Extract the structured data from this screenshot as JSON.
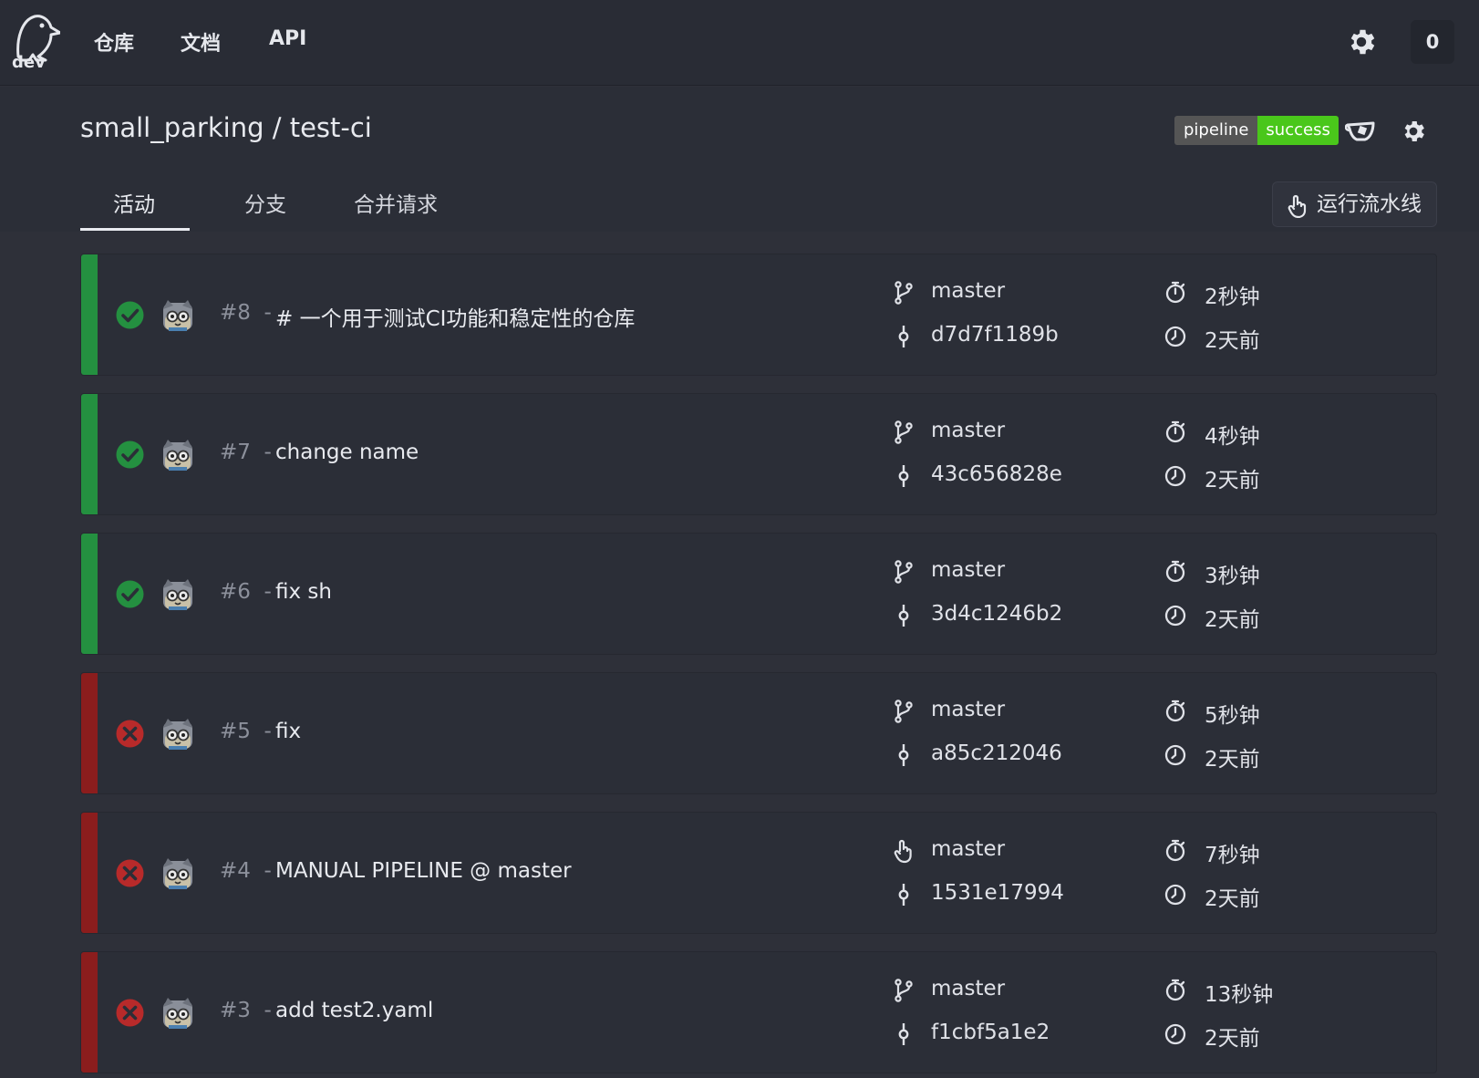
{
  "topbar": {
    "logo_text": "dev",
    "nav": [
      "仓库",
      "文档",
      "API"
    ],
    "counter": "0"
  },
  "header": {
    "repo_title": "small_parking / test-ci",
    "badge_left": "pipeline",
    "badge_right": "success",
    "tabs": [
      "活动",
      "分支",
      "合并请求"
    ],
    "run_button": "运行流水线"
  },
  "colors": {
    "success": "#249040",
    "failure": "#8b1d1d",
    "badge_success": "#4ac71b"
  },
  "pipelines": [
    {
      "number": "#8",
      "sep": "-",
      "message": "# 一个用于测试CI功能和稳定性的仓库",
      "status": "success",
      "trigger": "push",
      "branch": "master",
      "commit": "d7d7f1189b",
      "duration": "2秒钟",
      "created": "2天前"
    },
    {
      "number": "#7",
      "sep": "-",
      "message": "change name",
      "status": "success",
      "trigger": "push",
      "branch": "master",
      "commit": "43c656828e",
      "duration": "4秒钟",
      "created": "2天前"
    },
    {
      "number": "#6",
      "sep": "-",
      "message": "fix sh",
      "status": "success",
      "trigger": "push",
      "branch": "master",
      "commit": "3d4c1246b2",
      "duration": "3秒钟",
      "created": "2天前"
    },
    {
      "number": "#5",
      "sep": "-",
      "message": "fix",
      "status": "failure",
      "trigger": "push",
      "branch": "master",
      "commit": "a85c212046",
      "duration": "5秒钟",
      "created": "2天前"
    },
    {
      "number": "#4",
      "sep": "-",
      "message": "MANUAL PIPELINE @ master",
      "status": "failure",
      "trigger": "manual",
      "branch": "master",
      "commit": "1531e17994",
      "duration": "7秒钟",
      "created": "2天前"
    },
    {
      "number": "#3",
      "sep": "-",
      "message": "add test2.yaml",
      "status": "failure",
      "trigger": "push",
      "branch": "master",
      "commit": "f1cbf5a1e2",
      "duration": "13秒钟",
      "created": "2天前"
    }
  ]
}
